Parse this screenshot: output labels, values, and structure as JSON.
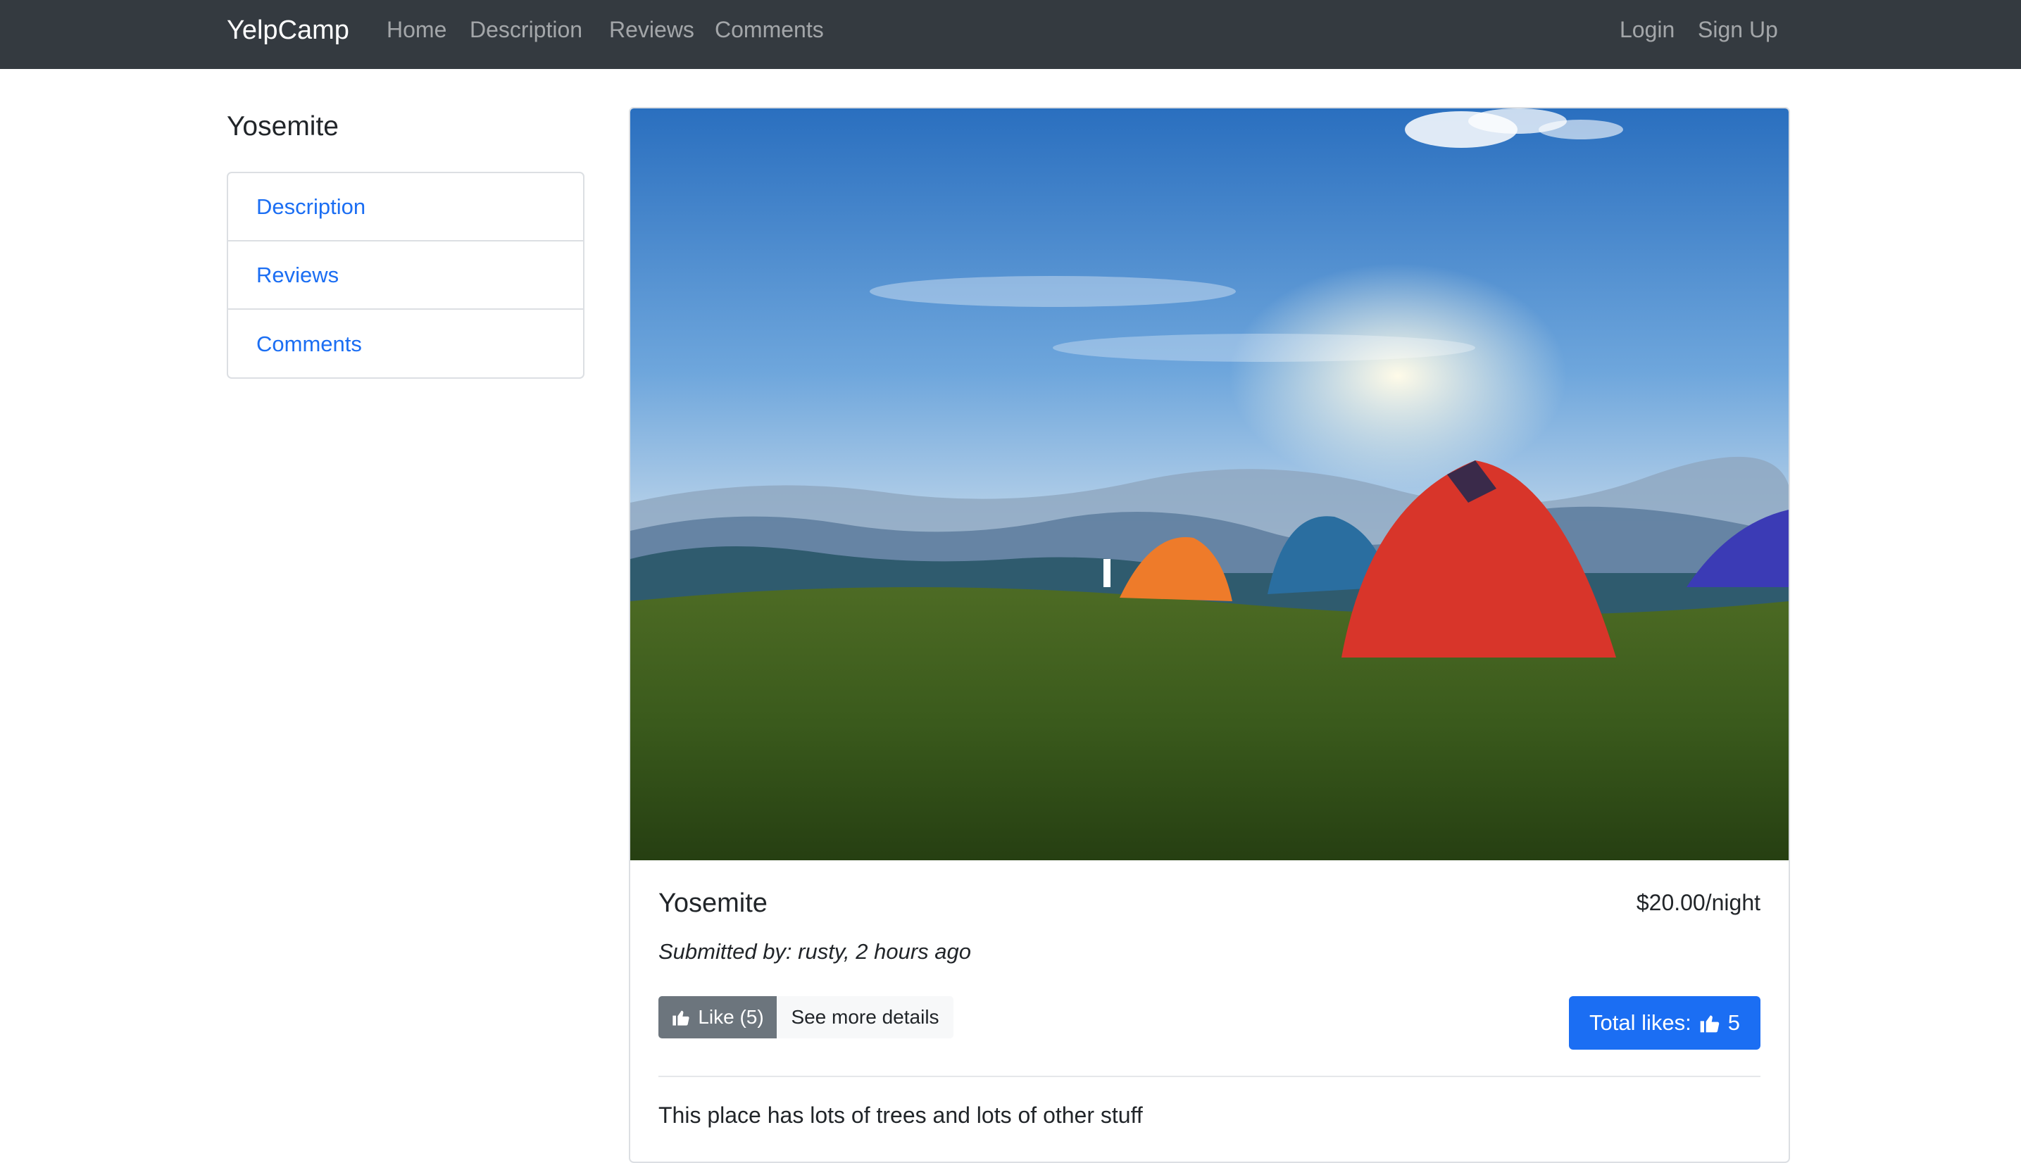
{
  "navbar": {
    "brand": "YelpCamp",
    "links": [
      "Home",
      "Description",
      "Reviews",
      "Comments"
    ],
    "login": "Login",
    "signup": "Sign Up"
  },
  "sidebar": {
    "title": "Yosemite",
    "items": [
      "Description",
      "Reviews",
      "Comments"
    ]
  },
  "campground": {
    "name": "Yosemite",
    "price": "$20.00/night",
    "submitted": "Submitted by: rusty, 2 hours ago",
    "like_label": "Like (5)",
    "details_label": "See more details",
    "total_likes_label": "Total likes:",
    "total_likes_count": "5",
    "description": "This place has lots of trees and lots of other stuff"
  },
  "colors": {
    "navbar_bg": "#343a40",
    "link_blue": "#1b6ef3",
    "secondary_btn": "#6c757d",
    "primary_btn": "#1b6ef3"
  },
  "icons": [
    "thumbs-up-icon"
  ]
}
